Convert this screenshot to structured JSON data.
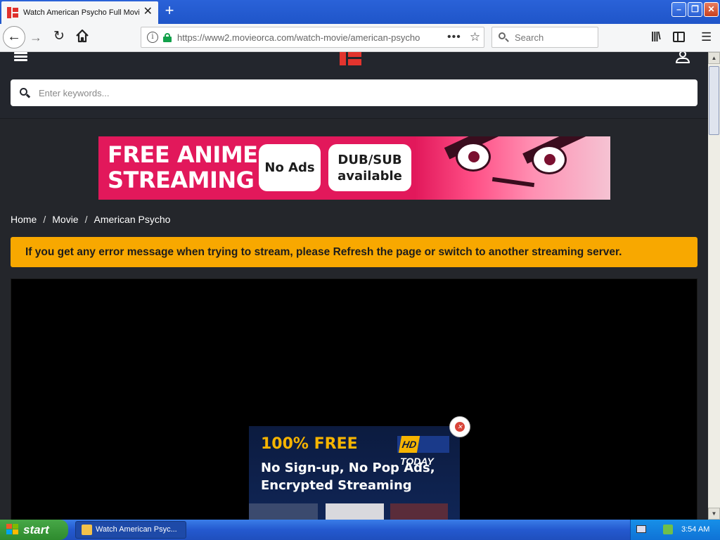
{
  "browser": {
    "tab_title": "Watch American Psycho Full Movie",
    "tab_close": "✕",
    "new_tab": "+",
    "url": "https://www2.movieorca.com/watch-movie/american-psycho",
    "search_placeholder": "Search",
    "window_controls": {
      "minimize": "–",
      "restore": "❐",
      "close": "✕"
    }
  },
  "site": {
    "keyword_placeholder": "Enter keywords...",
    "banner": {
      "title_line1": "FREE ANIME",
      "title_line2": "STREAMING",
      "pill1": "No Ads",
      "pill2_line1": "DUB/SUB",
      "pill2_line2": "available"
    },
    "breadcrumb": {
      "home": "Home",
      "movie": "Movie",
      "current": "American Psycho",
      "separator": "/"
    },
    "alert": "If you get any error message when trying to stream, please Refresh the page or switch to another streaming server.",
    "overlay_ad": {
      "headline": "100% FREE",
      "logo_hd": "HD",
      "logo_today": "TODAY",
      "line1": "No Sign-up, No Pop Ads,",
      "line2": "Encrypted Streaming",
      "close": "✕"
    }
  },
  "taskbar": {
    "start": "start",
    "task_title": "Watch American Psyc...",
    "clock": "3:54 AM"
  },
  "colors": {
    "accent_red": "#e3342e",
    "alert_yellow": "#f8a800",
    "banner_pink": "#e2185b",
    "ad_gold": "#f6b400"
  }
}
